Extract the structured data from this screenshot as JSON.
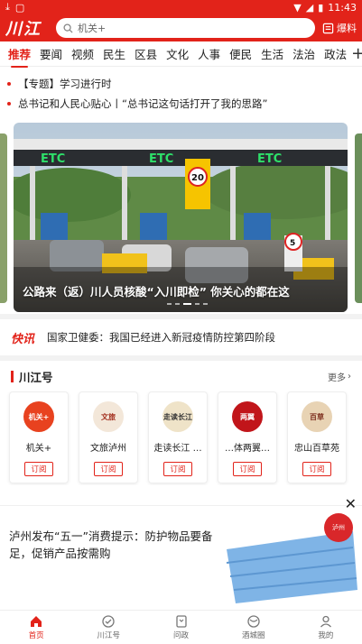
{
  "status_bar": {
    "time": "11:43"
  },
  "header": {
    "logo_text": "川江",
    "search_placeholder": "机关+",
    "report_label": "爆料"
  },
  "tabs": [
    "推荐",
    "要闻",
    "视频",
    "民生",
    "区县",
    "文化",
    "人事",
    "便民",
    "生活",
    "法治",
    "政法"
  ],
  "headlines": [
    "【专题】学习进行时",
    "总书记和人民心贴心丨“总书记这句话打开了我的思路”"
  ],
  "carousel": {
    "caption": "公路来（返）川人员核酸“入川即检” 你关心的都在这",
    "sign_etc": "ETC",
    "sign_speed": "20",
    "sign_speed2": "5"
  },
  "flash": {
    "label": "快讯",
    "text": "国家卫健委：我国已经进入新冠疫情防控第四阶段"
  },
  "chuanjianghao": {
    "title": "川江号",
    "more_label": "更多",
    "subscribe_label": "订阅",
    "accounts": [
      {
        "name": "机关+",
        "avatar_text": "机关+",
        "color": "#e8421f"
      },
      {
        "name": "文旅泸州",
        "avatar_text": "文旅",
        "color": "#f3e7d9"
      },
      {
        "name": "走读长江 …",
        "avatar_text": "走读长江",
        "color": "#efe3c8"
      },
      {
        "name": "…体两翼…",
        "avatar_text": "两翼",
        "color": "#c1151a"
      },
      {
        "name": "忠山百草苑",
        "avatar_text": "百草",
        "color": "#e8d3b4"
      }
    ]
  },
  "ad": {
    "title": "泸州发布“五一”消费提示：防护物品要备足，促销产品按需购",
    "badge_text": "泸州"
  },
  "bottom_nav": [
    "首页",
    "川江号",
    "问政",
    "酒城圈",
    "我的"
  ]
}
